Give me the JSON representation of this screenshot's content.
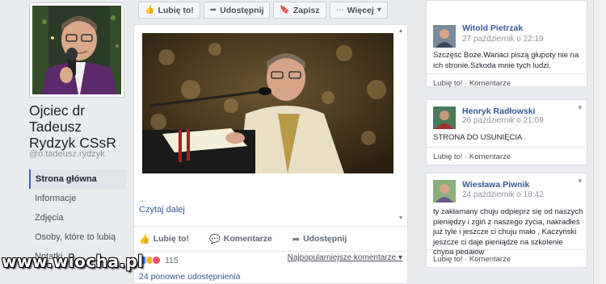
{
  "page": {
    "name": "Ojciec dr Tadeusz Rydzyk CSsR",
    "handle": "@o.tadeusz.rydzyk"
  },
  "nav": [
    {
      "label": "Strona główna",
      "active": true
    },
    {
      "label": "Informacje"
    },
    {
      "label": "Zdjęcia"
    },
    {
      "label": "Osoby, które to lubią"
    },
    {
      "label": "Notatki"
    }
  ],
  "actionbar": {
    "like": "Lubię to!",
    "share": "Udostępnij",
    "save": "Zapisz",
    "more": "Więcej"
  },
  "post": {
    "ellipsis": "...",
    "read_more": "Czytaj dalej",
    "actions": {
      "like": "Lubię to!",
      "comment": "Komentarze",
      "share": "Udostępnij"
    },
    "reaction_count": "115",
    "top_comments": "Najpopularniejsze komentarze",
    "shares": "24 ponowne udostępnienia"
  },
  "comments": [
    {
      "name": "Witold Pietrzak",
      "time": "27 październik o 22:19",
      "text": "Szczęść Boże.Wariaci piszą głupoty nie na ich stronie.Szkoda mnie tych ludzi.",
      "like": "Lubię to!",
      "comment": "Komentarze"
    },
    {
      "name": "Henryk Radłowski",
      "time": "26 październik o 21:09",
      "text": "STRONA DO USUNIĘCIA",
      "like": "Lubię to!",
      "comment": "Komentarze"
    },
    {
      "name": "Wiesława Piwnik",
      "time": "24 październik o 18:42",
      "text": "ty zakłamany chuju odpieprz się od naszych pieniędzy i zgiń z naszego życia, nakradłeś już tyle i jeszcze ci chuju mało , Kaczyński jeszcze ci daje pieniądze na szkolenie chyba pedałów",
      "like": "Lubię to!",
      "comment": "Komentarze"
    }
  ],
  "watermark": "www.wiocha.pl",
  "colors": {
    "link": "#365899",
    "accent": "#4267b2",
    "background": "#e9ebee"
  }
}
